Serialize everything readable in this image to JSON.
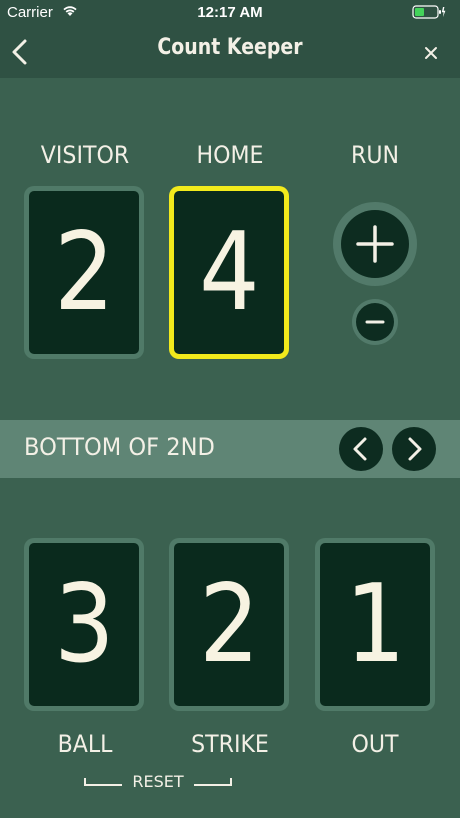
{
  "status_bar": {
    "carrier": "Carrier",
    "time": "12:17 AM"
  },
  "nav": {
    "title": "Count Keeper",
    "back_icon": "chevron-left-icon",
    "close_icon": "close-icon"
  },
  "score": {
    "visitor_label": "VISITOR",
    "home_label": "HOME",
    "run_label": "RUN",
    "visitor_value": "2",
    "home_value": "4",
    "selected": "home"
  },
  "inning": {
    "text": "BOTTOM OF 2ND",
    "prev_icon": "chevron-left-icon",
    "next_icon": "chevron-right-icon"
  },
  "count": {
    "ball_label": "BALL",
    "strike_label": "STRIKE",
    "out_label": "OUT",
    "ball_value": "3",
    "strike_value": "2",
    "out_value": "1",
    "reset_label": "RESET"
  },
  "colors": {
    "background": "#3b6150",
    "bar": "#2f5143",
    "card": "#0a2a1d",
    "highlight": "#f2ea1c"
  }
}
